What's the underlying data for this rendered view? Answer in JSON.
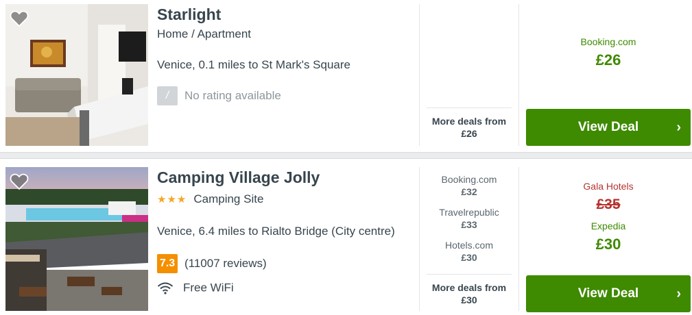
{
  "listings": [
    {
      "name": "Starlight",
      "type": "Home / Apartment",
      "stars": "",
      "location": "Venice, 0.1 miles to St Mark's Square",
      "rating_value": "/",
      "rating_text": "No rating available",
      "amenity": "",
      "deals": [],
      "more_deals_label": "More deals from",
      "more_deals_price": "£26",
      "best": {
        "provider": "Booking.com",
        "price": "£26"
      },
      "view_deal_label": "View Deal",
      "chevron": "›",
      "favorite_icon": "heart-icon"
    },
    {
      "name": "Camping Village Jolly",
      "type": "Camping Site",
      "stars": "★★★",
      "location": "Venice, 6.4 miles to Rialto Bridge (City centre)",
      "rating_value": "7.3",
      "rating_text": "(11007 reviews)",
      "amenity": "Free WiFi",
      "amenity_icon": "wifi-icon",
      "deals": [
        {
          "provider": "Booking.com",
          "price": "£32"
        },
        {
          "provider": "Travelrepublic",
          "price": "£33"
        },
        {
          "provider": "Hotels.com",
          "price": "£30"
        }
      ],
      "more_deals_label": "More deals from",
      "more_deals_price": "£30",
      "old_offer": {
        "provider": "Gala Hotels",
        "price": "£35"
      },
      "best": {
        "provider": "Expedia",
        "price": "£30"
      },
      "view_deal_label": "View Deal",
      "chevron": "›",
      "favorite_icon": "heart-icon"
    }
  ],
  "colors": {
    "accent_green": "#3e8a00",
    "price_green": "#3e8a00",
    "strike_red": "#b5332e",
    "rating_orange": "#f48f00",
    "rating_none": "#d1d5d8",
    "star_yellow": "#f5a623"
  }
}
